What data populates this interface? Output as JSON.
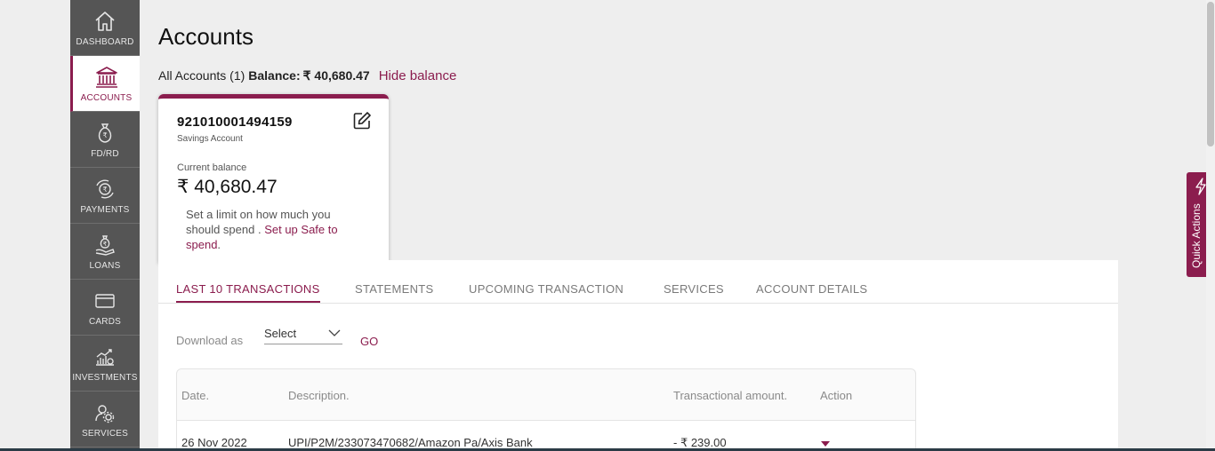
{
  "sidebar": {
    "items": [
      {
        "label": "DASHBOARD",
        "icon": "home-icon"
      },
      {
        "label": "ACCOUNTS",
        "icon": "bank-icon",
        "active": true
      },
      {
        "label": "FD/RD",
        "icon": "money-bag-icon"
      },
      {
        "label": "PAYMENTS",
        "icon": "payments-icon"
      },
      {
        "label": "LOANS",
        "icon": "loan-icon"
      },
      {
        "label": "CARDS",
        "icon": "card-icon"
      },
      {
        "label": "INVESTMENTS",
        "icon": "investments-icon"
      },
      {
        "label": "SERVICES",
        "icon": "services-icon"
      }
    ]
  },
  "page": {
    "title": "Accounts",
    "summary_prefix": "All Accounts (1)",
    "balance_label": "Balance:",
    "balance_value": "₹ 40,680.47",
    "hide_balance": "Hide balance"
  },
  "account_card": {
    "account_number": "921010001494159",
    "account_type": "Savings Account",
    "current_balance_label": "Current balance",
    "current_balance": "₹ 40,680.47",
    "limit_text": "Set a limit on how much you should spend .",
    "limit_link": "Set up Safe to spend",
    "limit_suffix": "."
  },
  "tabs": [
    {
      "label": "LAST 10 TRANSACTIONS",
      "active": true
    },
    {
      "label": "STATEMENTS"
    },
    {
      "label": "UPCOMING TRANSACTION"
    },
    {
      "label": "SERVICES"
    },
    {
      "label": "ACCOUNT DETAILS"
    }
  ],
  "download": {
    "label": "Download as",
    "selected": "Select",
    "go": "GO"
  },
  "table": {
    "headers": {
      "date": "Date.",
      "description": "Description.",
      "amount": "Transactional amount.",
      "action": "Action"
    },
    "rows": [
      {
        "date": "26 Nov 2022",
        "description": "UPI/P2M/233073470682/Amazon Pa/Axis Bank",
        "amount": "- ₹ 239.00"
      }
    ]
  },
  "quick_actions": {
    "label": "Quick Actions"
  },
  "colors": {
    "brand": "#8b1d4e",
    "sidebar": "#555555",
    "background": "#eeeeee"
  }
}
